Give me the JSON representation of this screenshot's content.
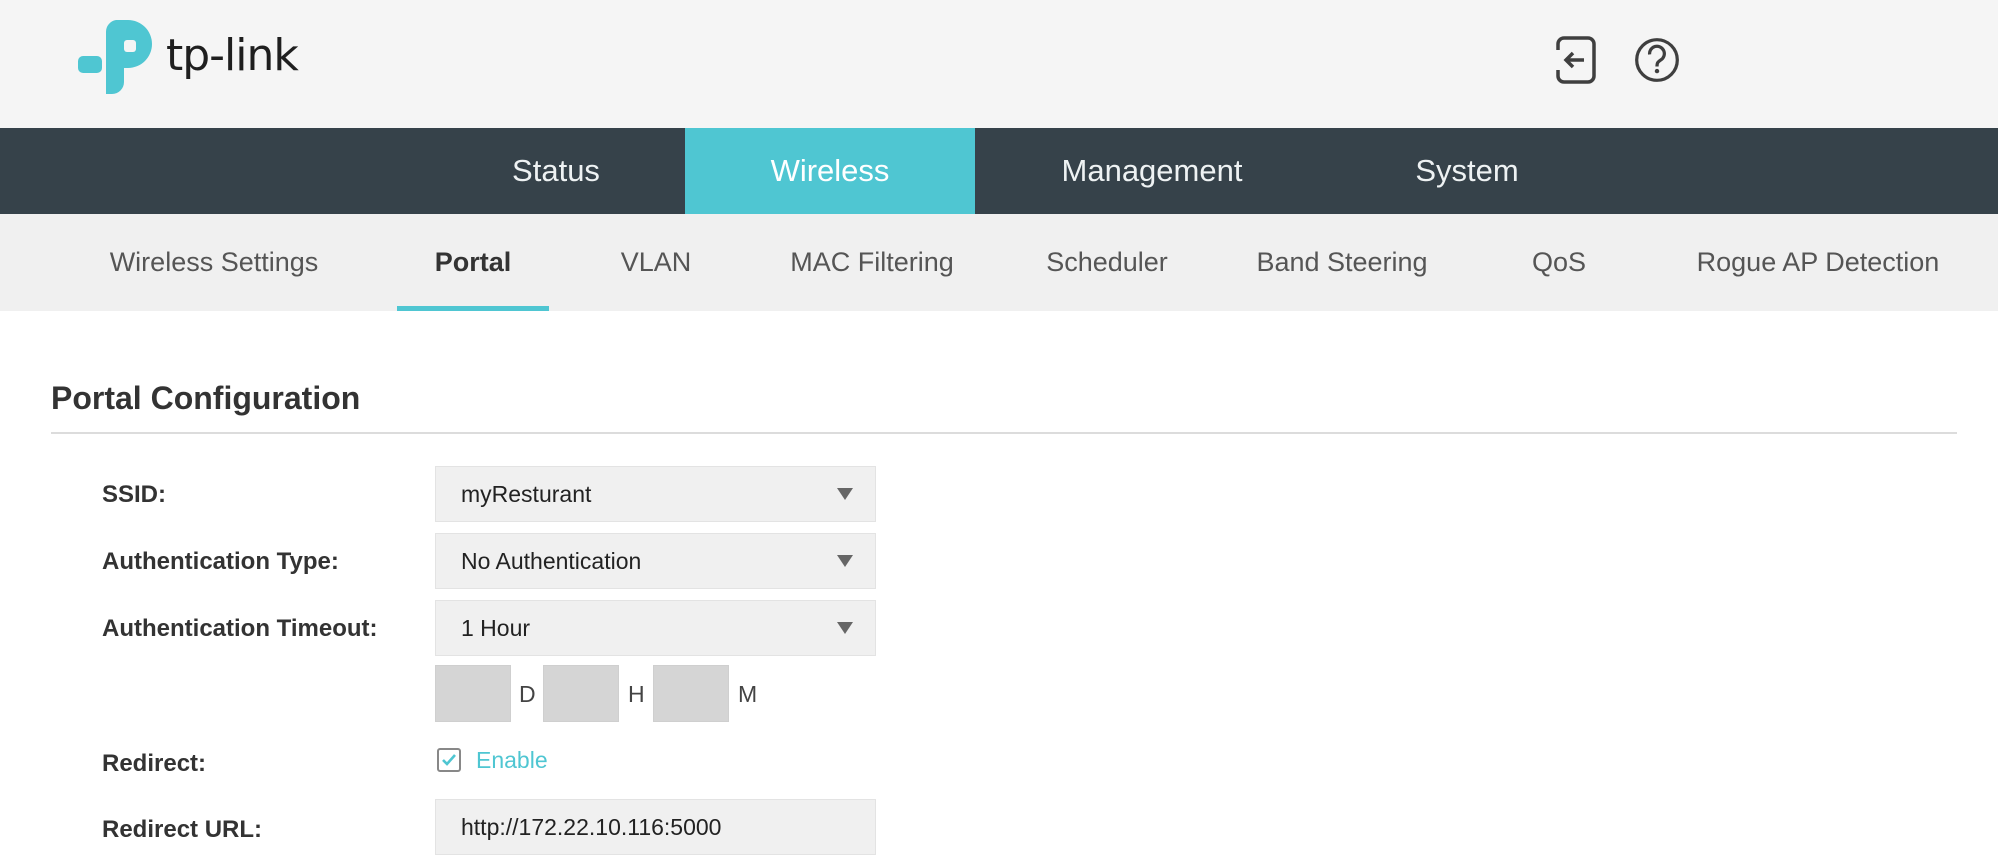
{
  "header": {
    "logo_text": "tp-link",
    "logout_icon": "logout-icon",
    "help_icon": "help-icon",
    "accent_color": "#4fc6d2"
  },
  "main_nav": {
    "tabs": [
      {
        "label": "Status",
        "active": false
      },
      {
        "label": "Wireless",
        "active": true
      },
      {
        "label": "Management",
        "active": false
      },
      {
        "label": "System",
        "active": false
      }
    ]
  },
  "sub_nav": {
    "tabs": [
      {
        "label": "Wireless Settings",
        "active": false
      },
      {
        "label": "Portal",
        "active": true
      },
      {
        "label": "VLAN",
        "active": false
      },
      {
        "label": "MAC Filtering",
        "active": false
      },
      {
        "label": "Scheduler",
        "active": false
      },
      {
        "label": "Band Steering",
        "active": false
      },
      {
        "label": "QoS",
        "active": false
      },
      {
        "label": "Rogue AP Detection",
        "active": false
      }
    ]
  },
  "portal": {
    "title": "Portal Configuration",
    "ssid": {
      "label": "SSID:",
      "value": "myResturant"
    },
    "auth_type": {
      "label": "Authentication Type:",
      "value": "No Authentication"
    },
    "auth_timeout": {
      "label": "Authentication Timeout:",
      "value": "1 Hour",
      "days": "",
      "hours": "",
      "minutes": "",
      "unit_days": "D",
      "unit_hours": "H",
      "unit_minutes": "M"
    },
    "redirect": {
      "label": "Redirect:",
      "checkbox_label": "Enable",
      "checked": true
    },
    "redirect_url": {
      "label": "Redirect URL:",
      "value": "http://172.22.10.116:5000"
    }
  }
}
